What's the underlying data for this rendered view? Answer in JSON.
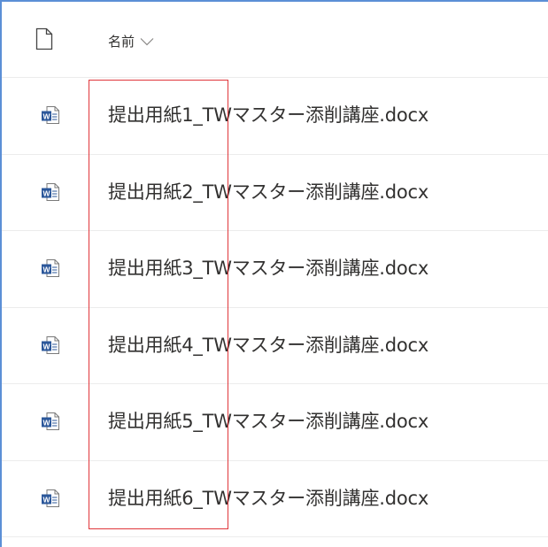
{
  "header": {
    "name_column_label": "名前",
    "file_icon": "document-outline-icon",
    "sort_icon": "chevron-down-icon"
  },
  "files": [
    {
      "name": "提出用紙1_TWマスター添削講座.docx",
      "icon": "word-doc-icon"
    },
    {
      "name": "提出用紙2_TWマスター添削講座.docx",
      "icon": "word-doc-icon"
    },
    {
      "name": "提出用紙3_TWマスター添削講座.docx",
      "icon": "word-doc-icon"
    },
    {
      "name": "提出用紙4_TWマスター添削講座.docx",
      "icon": "word-doc-icon"
    },
    {
      "name": "提出用紙5_TWマスター添削講座.docx",
      "icon": "word-doc-icon"
    },
    {
      "name": "提出用紙6_TWマスター添削講座.docx",
      "icon": "word-doc-icon"
    }
  ],
  "colors": {
    "frame_border": "#5b8fd6",
    "highlight_border": "#e0363b",
    "word_blue": "#2b579a",
    "text": "#323130"
  }
}
